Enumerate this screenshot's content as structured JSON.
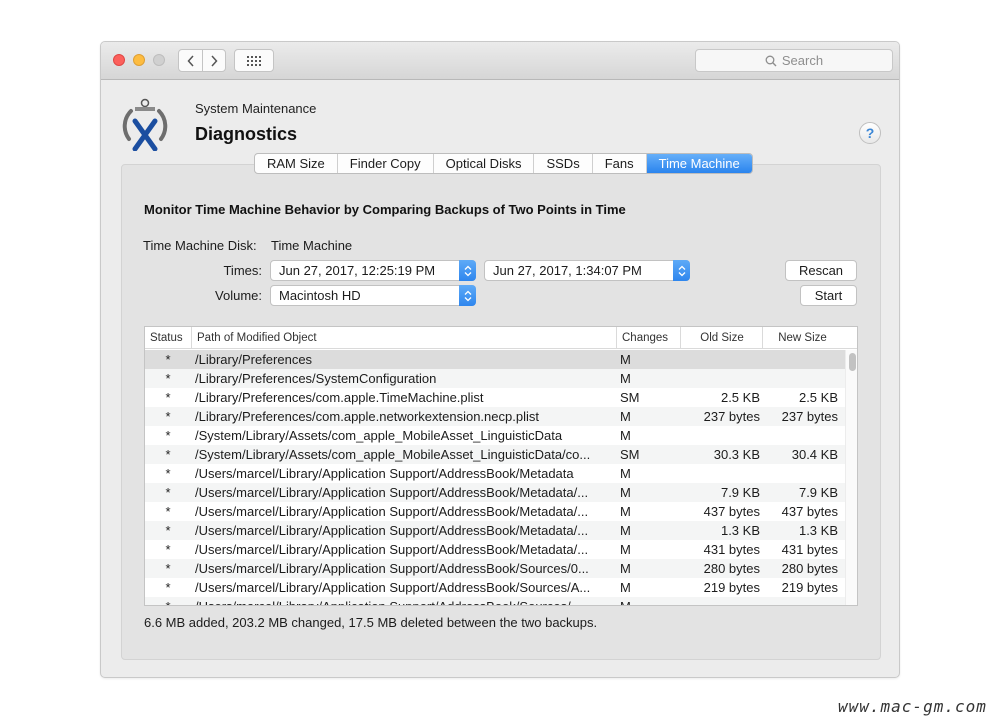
{
  "search": {
    "placeholder": "Search",
    "icon": "search-icon"
  },
  "header": {
    "subtitle": "System Maintenance",
    "title": "Diagnostics",
    "help_label": "?"
  },
  "tabs": [
    {
      "label": "RAM Size",
      "active": false
    },
    {
      "label": "Finder Copy",
      "active": false
    },
    {
      "label": "Optical Disks",
      "active": false
    },
    {
      "label": "SSDs",
      "active": false
    },
    {
      "label": "Fans",
      "active": false
    },
    {
      "label": "Time Machine",
      "active": true
    }
  ],
  "main": {
    "heading": "Monitor Time Machine Behavior by Comparing Backups of Two Points in Time",
    "disk_label": "Time Machine Disk:",
    "disk_value": "Time Machine",
    "times_label": "Times:",
    "time_from": "Jun 27, 2017, 12:25:19 PM",
    "time_to": "Jun 27, 2017, 1:34:07 PM",
    "volume_label": "Volume:",
    "volume_value": "Macintosh HD",
    "rescan_label": "Rescan",
    "start_label": "Start",
    "summary": "6.6 MB added, 203.2 MB changed, 17.5 MB deleted between the two backups."
  },
  "table": {
    "columns": [
      "Status",
      "Path of Modified Object",
      "Changes",
      "Old Size",
      "New Size"
    ],
    "rows": [
      {
        "status": "*",
        "path": "/Library/Preferences",
        "changes": "M",
        "old": "",
        "new": ""
      },
      {
        "status": "*",
        "path": "/Library/Preferences/SystemConfiguration",
        "changes": "M",
        "old": "",
        "new": ""
      },
      {
        "status": "*",
        "path": "/Library/Preferences/com.apple.TimeMachine.plist",
        "changes": "SM",
        "old": "2.5 KB",
        "new": "2.5 KB"
      },
      {
        "status": "*",
        "path": "/Library/Preferences/com.apple.networkextension.necp.plist",
        "changes": "M",
        "old": "237 bytes",
        "new": "237 bytes"
      },
      {
        "status": "*",
        "path": "/System/Library/Assets/com_apple_MobileAsset_LinguisticData",
        "changes": "M",
        "old": "",
        "new": ""
      },
      {
        "status": "*",
        "path": "/System/Library/Assets/com_apple_MobileAsset_LinguisticData/co...",
        "changes": "SM",
        "old": "30.3 KB",
        "new": "30.4 KB"
      },
      {
        "status": "*",
        "path": "/Users/marcel/Library/Application Support/AddressBook/Metadata",
        "changes": "M",
        "old": "",
        "new": ""
      },
      {
        "status": "*",
        "path": "/Users/marcel/Library/Application Support/AddressBook/Metadata/...",
        "changes": "M",
        "old": "7.9 KB",
        "new": "7.9 KB"
      },
      {
        "status": "*",
        "path": "/Users/marcel/Library/Application Support/AddressBook/Metadata/...",
        "changes": "M",
        "old": "437 bytes",
        "new": "437 bytes"
      },
      {
        "status": "*",
        "path": "/Users/marcel/Library/Application Support/AddressBook/Metadata/...",
        "changes": "M",
        "old": "1.3 KB",
        "new": "1.3 KB"
      },
      {
        "status": "*",
        "path": "/Users/marcel/Library/Application Support/AddressBook/Metadata/...",
        "changes": "M",
        "old": "431 bytes",
        "new": "431 bytes"
      },
      {
        "status": "*",
        "path": "/Users/marcel/Library/Application Support/AddressBook/Sources/0...",
        "changes": "M",
        "old": "280 bytes",
        "new": "280 bytes"
      },
      {
        "status": "*",
        "path": "/Users/marcel/Library/Application Support/AddressBook/Sources/A...",
        "changes": "M",
        "old": "219 bytes",
        "new": "219 bytes"
      },
      {
        "status": "*",
        "path": "/Users/marcel/Library/Application Support/AddressBook/Sources/...",
        "changes": "M",
        "old": "",
        "new": ""
      }
    ]
  },
  "watermark": "www.mac-gm.com",
  "colors": {
    "accent": "#2a84ee",
    "close": "#fc605c",
    "minimize": "#fdbc40",
    "help": "#3a86d6"
  }
}
